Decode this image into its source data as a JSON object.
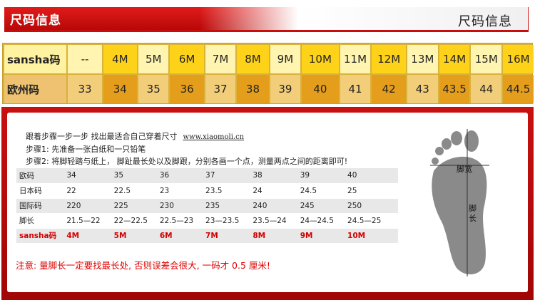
{
  "header": {
    "tab_title": "尺码信息",
    "right_title": "尺码信息"
  },
  "size_table": {
    "row1_label": "sansha码",
    "row2_label": "欧州码",
    "sansha": [
      "--",
      "4M",
      "5M",
      "6M",
      "7M",
      "8M",
      "9M",
      "10M",
      "11M",
      "12M",
      "13M",
      "14M",
      "15M",
      "16M"
    ],
    "euro": [
      "33",
      "34",
      "35",
      "36",
      "37",
      "38",
      "39",
      "40",
      "41",
      "42",
      "43",
      "43.5",
      "44",
      "44.5"
    ]
  },
  "guide": {
    "intro": "跟着步骤一步一步    找出最适合自己穿着尺寸",
    "url": "www.xiaomoli.cn",
    "step1": "步骤1: 先准备一张白纸和一只铅笔",
    "step2": "步骤2: 将脚轻踏与纸上， 脚趾最长处以及脚跟，分别各画一个点，测量两点之间的距离即可!"
  },
  "ref_table": {
    "rows": [
      {
        "label": "欧码",
        "cells": [
          "34",
          "35",
          "36",
          "37",
          "38",
          "39",
          "40"
        ]
      },
      {
        "label": "日本码",
        "cells": [
          "22",
          "22.5",
          "23",
          "23.5",
          "24",
          "24.5",
          "25"
        ]
      },
      {
        "label": "国际码",
        "cells": [
          "220",
          "225",
          "230",
          "235",
          "240",
          "245",
          "250"
        ]
      },
      {
        "label": "脚长",
        "cells": [
          "21.5—22",
          "22—22.5",
          "22.5—23",
          "23—23.5",
          "23.5—24",
          "24—24.5",
          "24.5—25"
        ]
      },
      {
        "label": "sansha码",
        "cells": [
          "4M",
          "5M",
          "6M",
          "7M",
          "8M",
          "9M",
          "10M"
        ]
      }
    ]
  },
  "note": "注意: 量脚长一定要找最长处, 否则误差会很大, 一码才 0.5 厘米!",
  "diagram": {
    "width_label": "脚宽",
    "length_label": "脚长"
  }
}
